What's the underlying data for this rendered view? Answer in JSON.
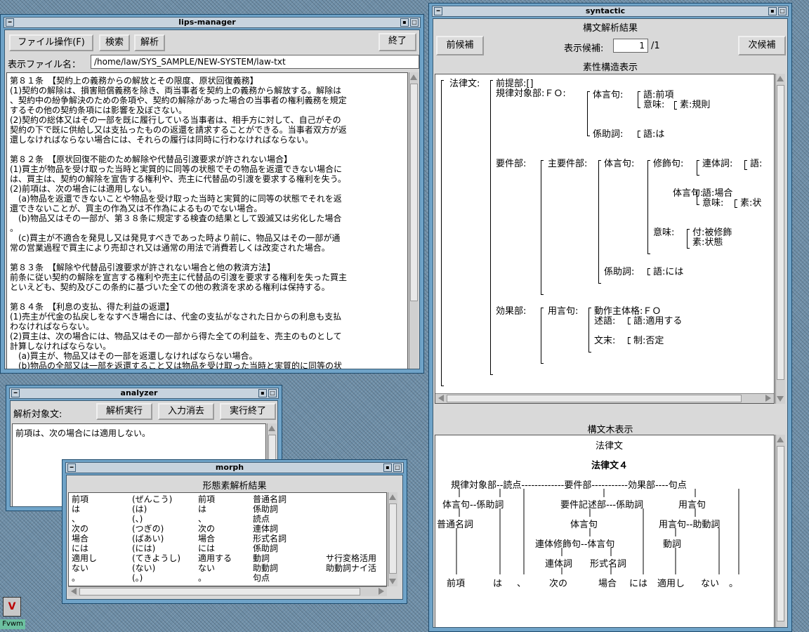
{
  "lips": {
    "title": "lips-manager",
    "btn_file": "ファイル操作(F)",
    "btn_search": "検索",
    "btn_analyze": "解析",
    "btn_quit": "終了",
    "file_label": "表示ファイル名：",
    "file_path": "/home/law/SYS_SAMPLE/NEW-SYSTEM/law-txt",
    "lines": [
      "第８１条　【契約上の義務からの解放とその限度、原状回復義務】",
      "(1)契約の解除は、損害賠償義務を除き、両当事者を契約上の義務から解放する。解除は",
      "、契約中の紛争解決のための条項や、契約の解除があった場合の当事者の権利義務を規定",
      "するその他の契約条項には影響を及ぼさない。",
      "(2)契約の総体又はその一部を既に履行している当事者は、相手方に対して、自己がその",
      "契約の下で既に供給し又は支払ったものの返還を請求することができる。当事者双方が返",
      "還しなければならない場合には、それらの履行は同時に行わなければならない。",
      "",
      "第８２条　【原状回復不能のため解除や代替品引渡要求が許されない場合】",
      "(1)買主が物品を受け取った当時と実質的に同等の状態でその物品を返還できない場合に",
      "は、買主は、契約の解除を宣告する権利や、売主に代替品の引渡を要求する権利を失う。",
      "(2)前項は、次の場合には適用しない。",
      "　(a)物品を返還できないことや物品を受け取った当時と実質的に同等の状態でそれを返",
      "還できないことが、買主の作為又は不作為によるものでない場合。",
      "　(b)物品又はその一部が、第３８条に規定する検査の結果として毀滅又は劣化した場合",
      "。",
      "　(c)買主が不適合を発見し又は発見すべきであった時より前に、物品又はその一部が通",
      "常の営業過程で買主により売却され又は通常の用法で消費若しくは改変された場合。",
      "",
      "第８３条　【解除や代替品引渡要求が許されない場合と他の救済方法】",
      "前条に従い契約の解除を宣言する権利や売主に代替品の引渡を要求する権利を失った買主",
      "といえども、契約及びこの条約に基づいた全ての他の救済を求める権利は保持する。",
      "",
      "第８４条　【利息の支払、得た利益の返還】",
      "(1)売主が代金の払戻しをなすべき場合には、代金の支払がなされた日からの利息も支払",
      "わなければならない。",
      "(2)買主は、次の場合には、物品又はその一部から得た全ての利益を、売主のものとして",
      "計算しなければならない。",
      "　(a)買主が、物品又はその一部を返還しなければならない場合。",
      "　(b)物品の全部又は一部を返還すること又は物品を受け取った当時と実質的に同等の状"
    ]
  },
  "analyzer": {
    "title": "analyzer",
    "label": "解析対象文:",
    "btn_run": "解析実行",
    "btn_clear": "入力消去",
    "btn_end": "実行終了",
    "input": "前項は、次の場合には適用しない。"
  },
  "morph": {
    "title": "morph",
    "header": "形態素解析結果",
    "rows": [
      [
        "前項",
        "(ぜんこう)",
        "前項",
        "普通名詞",
        ""
      ],
      [
        "は",
        "(は)",
        "は",
        "係助詞",
        ""
      ],
      [
        "、",
        "(、)",
        "、",
        "読点",
        ""
      ],
      [
        "次の",
        "(つぎの)",
        "次の",
        "連体詞",
        ""
      ],
      [
        "場合",
        "(ばあい)",
        "場合",
        "形式名詞",
        ""
      ],
      [
        "には",
        "(には)",
        "には",
        "係助詞",
        ""
      ],
      [
        "適用し",
        "(てきようし)",
        "適用する",
        "動詞",
        "サ行変格活用"
      ],
      [
        "ない",
        "(ない)",
        "ない",
        "助動詞",
        "助動詞ナイ活"
      ],
      [
        "。",
        "(。)",
        "。",
        "句点",
        ""
      ]
    ]
  },
  "syntactic": {
    "title": "syntactic",
    "header": "構文解析結果",
    "btn_prev": "前候補",
    "btn_next": "次候補",
    "cand_label": "表示候補:",
    "cand_value": "1",
    "cand_total": "/1",
    "struct_header": "素性構造表示",
    "tree_header": "構文木表示",
    "fs": {
      "law": "法律文:",
      "premise": "前提部:[]",
      "subject": "規律対象部:ＦＯ:",
      "taigen1": "体言句:",
      "go1": "語:前項",
      "imi1": "意味:",
      "so1": "素:規則",
      "kakari1": "係助詞:",
      "go2": "語:は",
      "req": "要件部:",
      "mainreq": "主要件部:",
      "taigen2": "体言句:",
      "shushoku": "修飾句:",
      "rentai": "連体詞:",
      "go3": "語:",
      "taigen3": "体言句:",
      "go4": "語:場合",
      "imi2": "意味:",
      "so2": "素:状",
      "imi3": "意味:",
      "fu": "付:被修飾",
      "so3": "素:状態",
      "kakari2": "係助詞:",
      "go5": "語:には",
      "effect": "効果部:",
      "yogen": "用言句:",
      "agent": "動作主体格:ＦＯ",
      "jutsugo": "述語:",
      "go6": "語:適用する",
      "bunmatsu": "文末:",
      "sei": "制:否定"
    },
    "tree": {
      "root": "法律文",
      "root4": "法律文４",
      "l1": "規律対象部--読点-------------要件部-----------効果部----句点",
      "n_taigen": "体言句--係助詞",
      "n_reqdesc": "要件記述部---係助詞",
      "n_yogen": "用言句",
      "n_futsu": "普通名詞",
      "n_taigen2": "体言句",
      "n_yogen2": "用言句--助動詞",
      "n_rentaishu": "連体修飾句--体言句",
      "n_doshi": "動詞",
      "n_rentai": "連体詞",
      "n_keishiki": "形式名詞",
      "leaves": [
        "前項",
        "は",
        "、",
        "次の",
        "場合",
        "には",
        "適用し",
        "ない",
        "。"
      ]
    }
  },
  "desktop": {
    "fvwm_label": "Fvwm"
  }
}
